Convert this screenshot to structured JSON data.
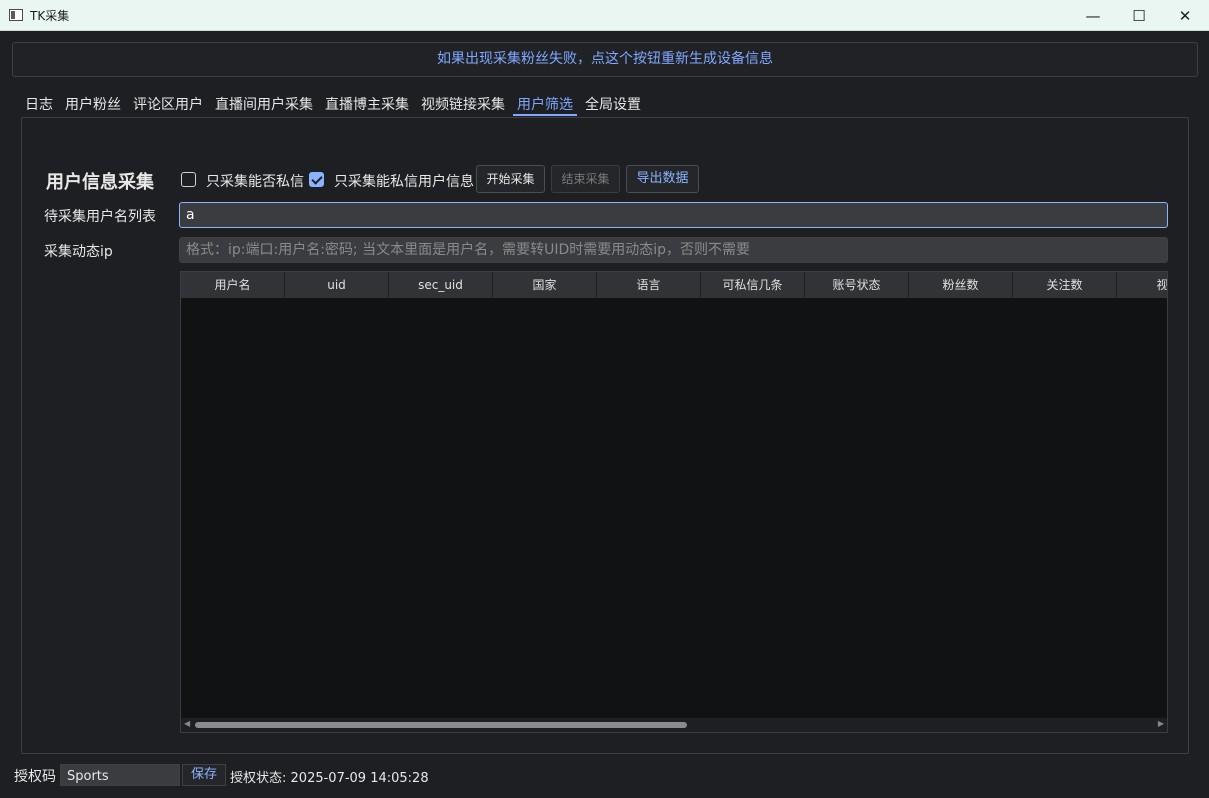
{
  "window": {
    "title": "TK采集",
    "minimize_glyph": "—",
    "maximize_glyph": "☐",
    "close_glyph": "✕"
  },
  "banner": {
    "text": "如果出现采集粉丝失败，点这个按钮重新生成设备信息"
  },
  "tabs": [
    {
      "label": "日志",
      "active": false
    },
    {
      "label": "用户粉丝",
      "active": false
    },
    {
      "label": "评论区用户",
      "active": false
    },
    {
      "label": "直播间用户采集",
      "active": false
    },
    {
      "label": "直播博主采集",
      "active": false
    },
    {
      "label": "视频链接采集",
      "active": false
    },
    {
      "label": "用户筛选",
      "active": true
    },
    {
      "label": "全局设置",
      "active": false
    }
  ],
  "section": {
    "title": "用户信息采集",
    "checkbox_dm_only": {
      "label": "只采集能否私信",
      "checked": false
    },
    "checkbox_dm_users": {
      "label": "只采集能私信用户信息",
      "checked": true
    },
    "start_button": "开始采集",
    "stop_button": "结束采集",
    "export_button": "导出数据"
  },
  "form": {
    "usernames_label": "待采集用户名列表",
    "usernames_value": "a",
    "proxy_label": "采集动态ip",
    "proxy_placeholder": "格式：ip:端口:用户名:密码;   当文本里面是用户名，需要转UID时需要用动态ip，否则不需要"
  },
  "table": {
    "columns": [
      "用户名",
      "uid",
      "sec_uid",
      "国家",
      "语言",
      "可私信几条",
      "账号状态",
      "粉丝数",
      "关注数",
      "视频"
    ],
    "rows": []
  },
  "footer": {
    "auth_label": "授权码",
    "auth_value": "Sports",
    "save_button": "保存",
    "status_label": "授权状态:",
    "status_value": "2025-07-09 14:05:28"
  },
  "colors": {
    "accent": "#8ab4ff",
    "background": "#1e1f22",
    "titlebar": "#e9f6f1"
  }
}
